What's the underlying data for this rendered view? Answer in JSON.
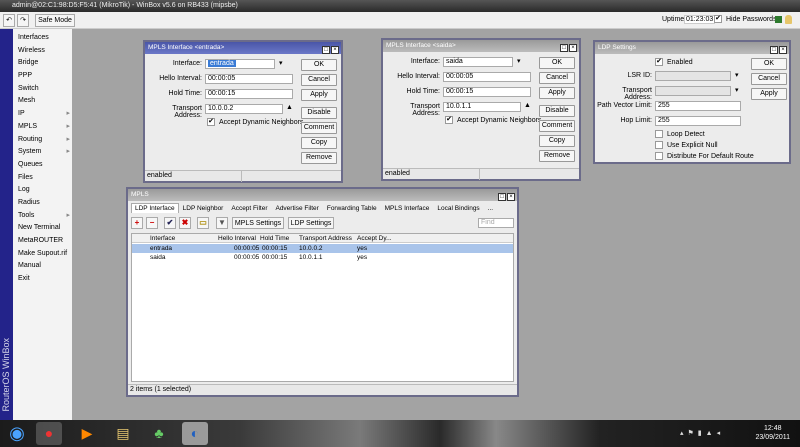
{
  "window_title": "admin@02:C1:98:D5:F5:41 (MikroTik) - WinBox v5.6 on RB433 (mipsbe)",
  "toolbar": {
    "undo": "↶",
    "redo": "↷",
    "safe_mode": "Safe Mode",
    "uptime_label": "Uptime:",
    "uptime": "01:23:03",
    "hide_passwords": "Hide Passwords"
  },
  "sidebar": {
    "brand": "RouterOS WinBox",
    "items": [
      {
        "label": "Interfaces",
        "sub": ""
      },
      {
        "label": "Wireless",
        "sub": ""
      },
      {
        "label": "Bridge",
        "sub": ""
      },
      {
        "label": "PPP",
        "sub": ""
      },
      {
        "label": "Switch",
        "sub": ""
      },
      {
        "label": "Mesh",
        "sub": ""
      },
      {
        "label": "IP",
        "sub": "▸"
      },
      {
        "label": "MPLS",
        "sub": "▸"
      },
      {
        "label": "Routing",
        "sub": "▸"
      },
      {
        "label": "System",
        "sub": "▸"
      },
      {
        "label": "Queues",
        "sub": ""
      },
      {
        "label": "Files",
        "sub": ""
      },
      {
        "label": "Log",
        "sub": ""
      },
      {
        "label": "Radius",
        "sub": ""
      },
      {
        "label": "Tools",
        "sub": "▸"
      },
      {
        "label": "New Terminal",
        "sub": ""
      },
      {
        "label": "MetaROUTER",
        "sub": ""
      },
      {
        "label": "Make Supout.rif",
        "sub": ""
      },
      {
        "label": "Manual",
        "sub": ""
      },
      {
        "label": "Exit",
        "sub": ""
      }
    ]
  },
  "win_entrada": {
    "title": "MPLS Interface <entrada>",
    "interface_label": "Interface:",
    "interface": "entrada",
    "hello_label": "Hello Interval:",
    "hello": "00:00:05",
    "hold_label": "Hold Time:",
    "hold": "00:00:15",
    "transport_label": "Transport Address:",
    "transport": "10.0.0.2",
    "accept": "Accept Dynamic Neighbors",
    "status": "enabled"
  },
  "win_saida": {
    "title": "MPLS Interface <saida>",
    "interface_label": "Interface:",
    "interface": "saida",
    "hello_label": "Hello Interval:",
    "hello": "00:00:05",
    "hold_label": "Hold Time:",
    "hold": "00:00:15",
    "transport_label": "Transport Address:",
    "transport": "10.0.1.1",
    "accept": "Accept Dynamic Neighbors",
    "status": "enabled"
  },
  "buttons": {
    "ok": "OK",
    "cancel": "Cancel",
    "apply": "Apply",
    "disable": "Disable",
    "comment": "Comment",
    "copy": "Copy",
    "remove": "Remove"
  },
  "ldp": {
    "title": "LDP Settings",
    "enabled": "Enabled",
    "lsr_label": "LSR ID:",
    "transport_label": "Transport Address:",
    "pvl_label": "Path Vector Limit:",
    "pvl": "255",
    "hop_label": "Hop Limit:",
    "hop": "255",
    "loop": "Loop Detect",
    "null": "Use Explicit Null",
    "dist": "Distribute For Default Route"
  },
  "mpls": {
    "title": "MPLS",
    "tabs": [
      "LDP Interface",
      "LDP Neighbor",
      "Accept Filter",
      "Advertise Filter",
      "Forwarding Table",
      "MPLS Interface",
      "Local Bindings",
      "..."
    ],
    "mpls_settings": "MPLS Settings",
    "ldp_settings": "LDP Settings",
    "find_placeholder": "Find",
    "columns": [
      "Interface",
      "Hello Interval",
      "Hold Time",
      "Transport Address",
      "Accept Dy..."
    ],
    "rows": [
      [
        "entrada",
        "00:00:05",
        "00:00:15",
        "10.0.0.2",
        "yes"
      ],
      [
        "saida",
        "00:00:05",
        "00:00:15",
        "10.0.1.1",
        "yes"
      ]
    ],
    "status": "2 items (1 selected)"
  },
  "clock": {
    "time": "12:48",
    "date": "23/09/2011"
  }
}
